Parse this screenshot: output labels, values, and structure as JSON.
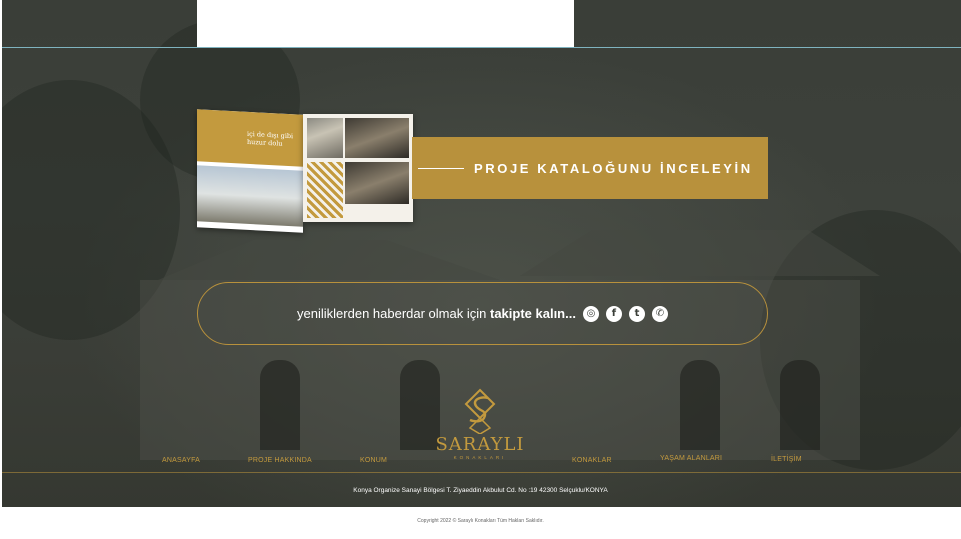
{
  "catalog": {
    "label": "PROJE KATALOĞUNU İNCELEYİN",
    "book_heading": "içi de dışı gibi huzur dolu"
  },
  "social": {
    "text_regular": "yeniliklerden haberdar olmak için",
    "text_bold": "takipte kalın...",
    "icons": [
      {
        "name": "instagram-icon",
        "glyph": "◎"
      },
      {
        "name": "facebook-icon",
        "glyph": "f"
      },
      {
        "name": "twitter-icon",
        "glyph": "t"
      },
      {
        "name": "whatsapp-icon",
        "glyph": "✆"
      }
    ]
  },
  "logo": {
    "name": "SARAYLI",
    "subtitle": "KONAKLARI"
  },
  "nav": {
    "items": [
      "ANASAYFA",
      "PROJE HAKKINDA",
      "KONUM",
      "KONAKLAR",
      "YAŞAM ALANLARI",
      "İLETİŞİM"
    ]
  },
  "footer": {
    "address": "Konya Organize Sanayi Bölgesi  T. Ziyaeddin Akbulut Cd. No :19 42300 Selçuklu/KONYA",
    "copyright": "Copyright 2022 © Saraylı Konakları     Tüm Hakları Saklıdır."
  },
  "colors": {
    "gold": "#b8913c",
    "dark_bg": "#3a3e38",
    "white": "#ffffff"
  }
}
